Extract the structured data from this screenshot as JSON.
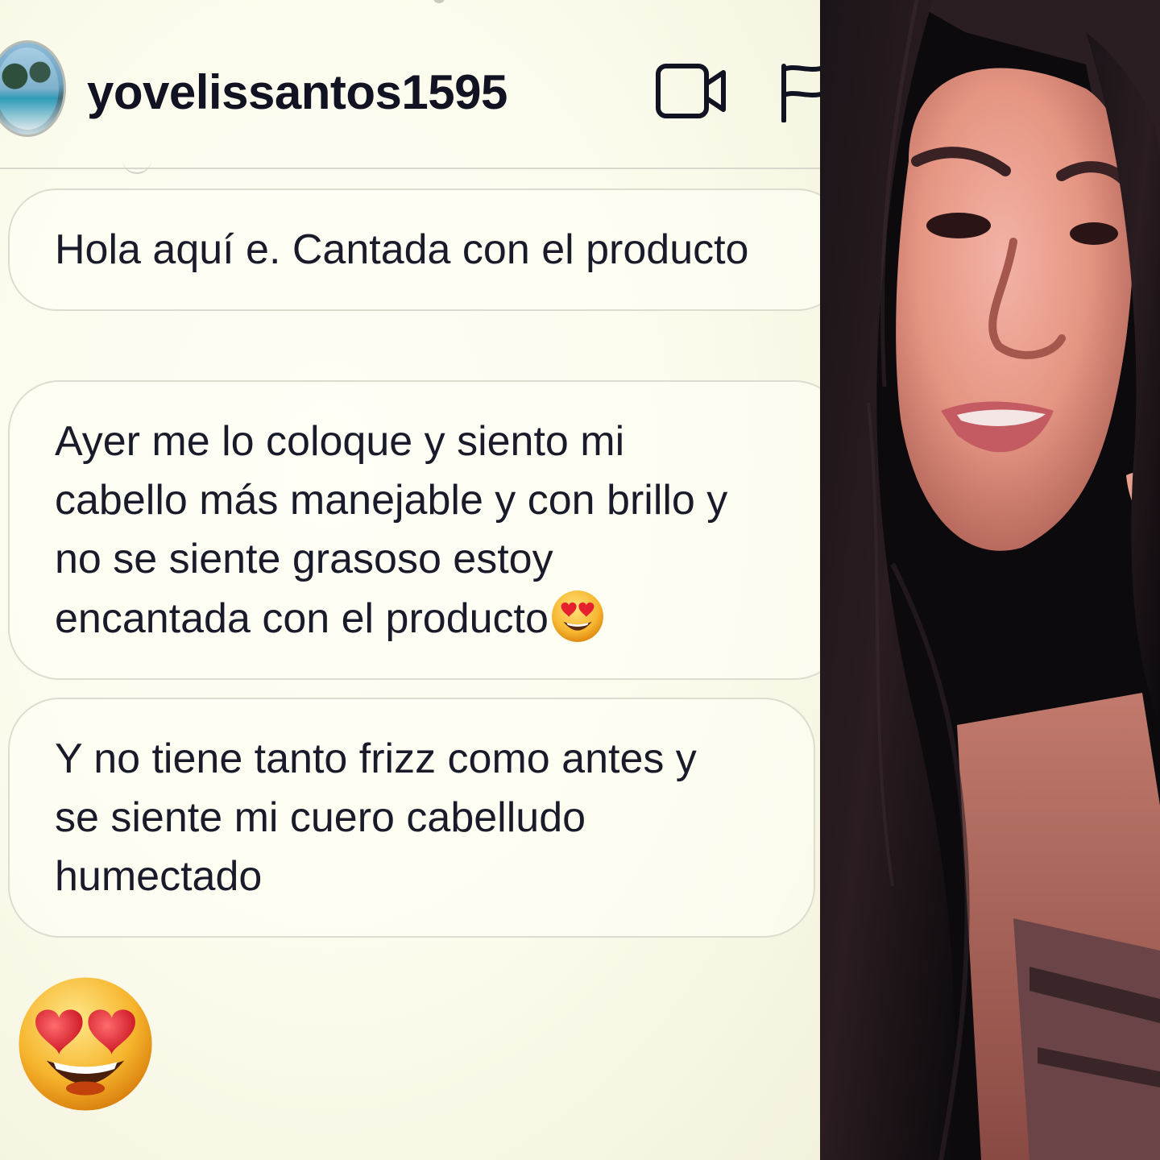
{
  "header": {
    "username": "yovelissantos1595",
    "avatar_icon": "profile-photo",
    "video_icon": "video-camera-icon",
    "flag_icon": "flag-icon"
  },
  "messages": [
    {
      "lines": [
        "Hola aquí e. Cantada con el producto"
      ]
    },
    {
      "lines": [
        "Ayer me lo coloque y siento mi",
        "cabello más manejable y con brillo y",
        "no se siente grasoso estoy",
        "encantada con el producto"
      ],
      "trailing_emoji": "heart-eyes-emoji"
    },
    {
      "lines": [
        "Y no tiene tanto frizz como antes y",
        "se siente mi cuero cabelludo",
        "humectado"
      ]
    }
  ],
  "reaction_emoji": "heart-eyes-emoji",
  "colors": {
    "chat_background": "#fbfbee",
    "bubble_border": "#dcdccf",
    "text": "#1a1b2a",
    "photo_background": "#0c0a0d"
  }
}
